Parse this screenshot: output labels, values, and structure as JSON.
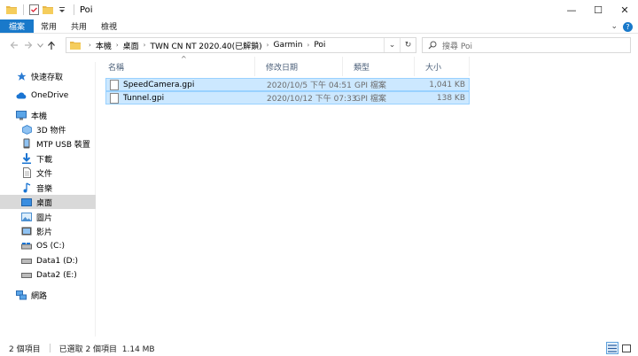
{
  "window": {
    "title": "Poi",
    "controls": [
      "—",
      "☐",
      "✕"
    ]
  },
  "ribbon": {
    "tabs": [
      "檔案",
      "常用",
      "共用",
      "檢視"
    ],
    "expand_glyph": "⌄",
    "help_glyph": "?"
  },
  "address": {
    "crumbs": [
      "本機",
      "桌面",
      "TWN CN NT 2020.40(已解鎖)",
      "Garmin",
      "Poi"
    ],
    "separator": "›",
    "dropdown_glyph": "⌄",
    "refresh_glyph": "↻"
  },
  "search": {
    "placeholder": "搜尋 Poi"
  },
  "sidebar": {
    "items": [
      {
        "label": "快速存取",
        "icon": "star-icon"
      },
      {
        "label": "OneDrive",
        "icon": "cloud-icon"
      },
      {
        "label": "本機",
        "icon": "computer-icon"
      },
      {
        "label": "3D 物件",
        "icon": "cube-icon"
      },
      {
        "label": "MTP USB 裝置",
        "icon": "phone-icon"
      },
      {
        "label": "下載",
        "icon": "download-icon"
      },
      {
        "label": "文件",
        "icon": "document-icon"
      },
      {
        "label": "音樂",
        "icon": "music-icon"
      },
      {
        "label": "桌面",
        "icon": "desktop-icon",
        "selected": true
      },
      {
        "label": "圖片",
        "icon": "picture-icon"
      },
      {
        "label": "影片",
        "icon": "video-icon"
      },
      {
        "label": "OS (C:)",
        "icon": "drive-icon"
      },
      {
        "label": "Data1 (D:)",
        "icon": "drive-icon"
      },
      {
        "label": "Data2 (E:)",
        "icon": "drive-icon"
      },
      {
        "label": "網路",
        "icon": "network-icon"
      }
    ]
  },
  "columns": [
    "名稱",
    "修改日期",
    "類型",
    "大小"
  ],
  "files": [
    {
      "name": "SpeedCamera.gpi",
      "date": "2020/10/5 下午 04:51",
      "type": "GPI 檔案",
      "size": "1,041 KB"
    },
    {
      "name": "Tunnel.gpi",
      "date": "2020/10/12 下午 07:33",
      "type": "GPI 檔案",
      "size": "138 KB"
    }
  ],
  "status": {
    "count": "2 個項目",
    "selected": "已選取 2 個項目  1.14 MB"
  },
  "colors": {
    "accent": "#1979ca",
    "selection": "#cce8ff",
    "selection_border": "#99d1ff"
  }
}
